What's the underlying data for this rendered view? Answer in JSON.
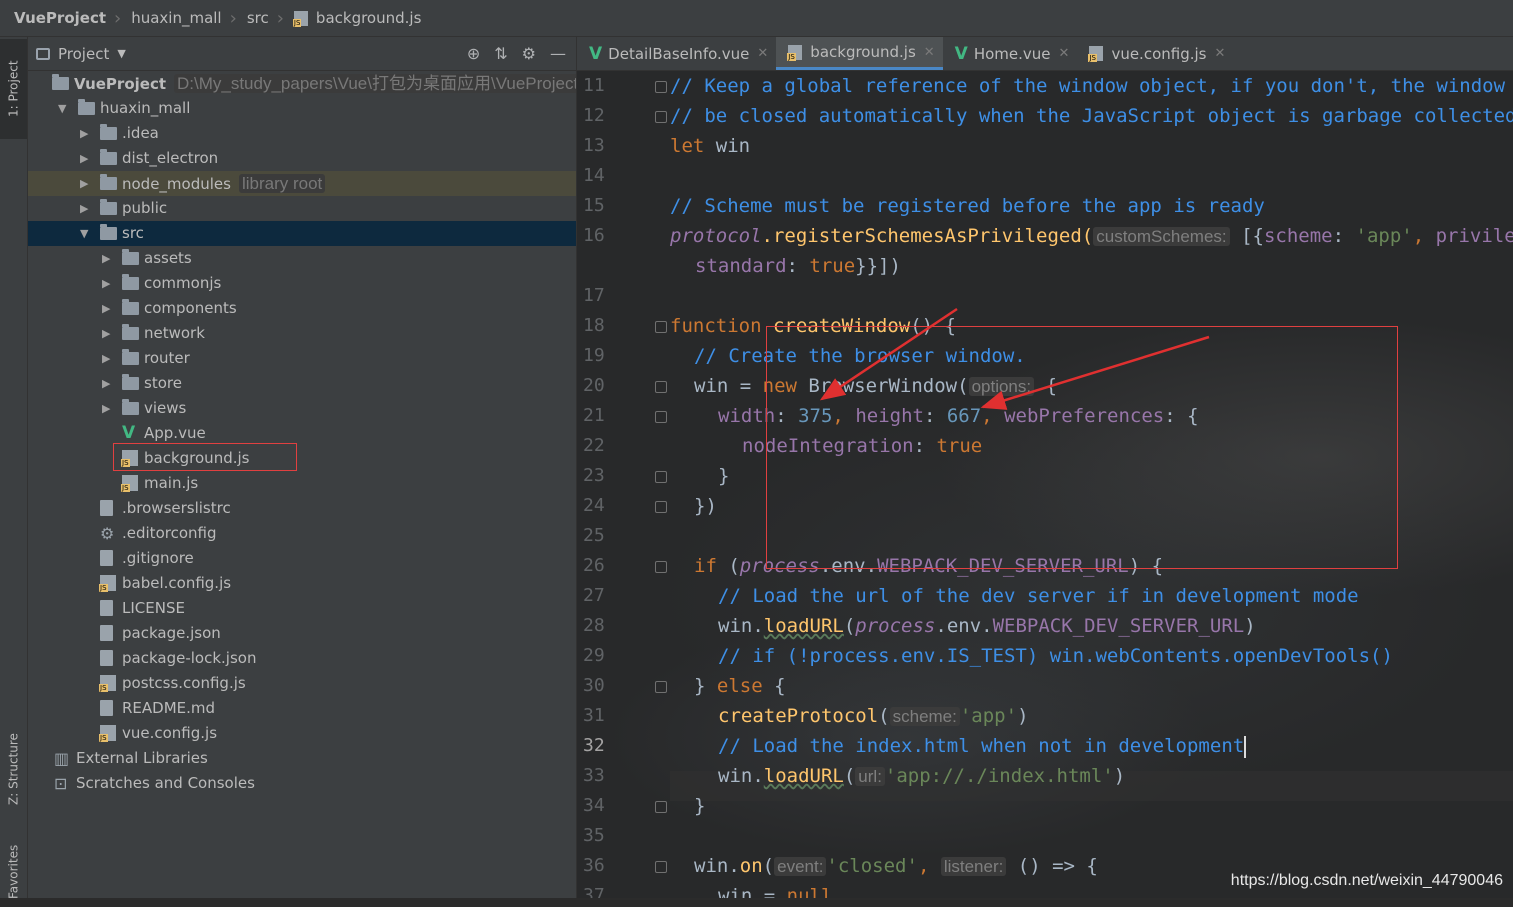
{
  "breadcrumb": [
    "VueProject",
    "huaxin_mall",
    "src",
    "background.js"
  ],
  "left_strip": {
    "project_tab": "1: Project",
    "structure_tab": "Z: Structure",
    "favorites_tab": "Favorites"
  },
  "project_panel": {
    "title": "Project",
    "tree": [
      {
        "label": "VueProject",
        "hint": "D:\\My_study_papers\\Vue\\打包为桌面应用\\VueProject",
        "type": "folder",
        "depth": 0,
        "expanded": true
      },
      {
        "label": "huaxin_mall",
        "type": "folder",
        "depth": 1,
        "expanded": true
      },
      {
        "label": ".idea",
        "type": "folder",
        "depth": 2
      },
      {
        "label": "dist_electron",
        "type": "folder",
        "depth": 2
      },
      {
        "label": "node_modules",
        "hint": "library root",
        "type": "folder",
        "depth": 2,
        "library": true
      },
      {
        "label": "public",
        "type": "folder",
        "depth": 2
      },
      {
        "label": "src",
        "type": "folder",
        "depth": 2,
        "expanded": true,
        "selected": true
      },
      {
        "label": "assets",
        "type": "folder",
        "depth": 3
      },
      {
        "label": "commonjs",
        "type": "folder",
        "depth": 3
      },
      {
        "label": "components",
        "type": "folder",
        "depth": 3
      },
      {
        "label": "network",
        "type": "folder",
        "depth": 3
      },
      {
        "label": "router",
        "type": "folder",
        "depth": 3
      },
      {
        "label": "store",
        "type": "folder",
        "depth": 3
      },
      {
        "label": "views",
        "type": "folder",
        "depth": 3
      },
      {
        "label": "App.vue",
        "type": "vue",
        "depth": 3
      },
      {
        "label": "background.js",
        "type": "js",
        "depth": 3,
        "highlighted": true
      },
      {
        "label": "main.js",
        "type": "js",
        "depth": 3
      },
      {
        "label": ".browserslistrc",
        "type": "file",
        "depth": 2
      },
      {
        "label": ".editorconfig",
        "type": "gear",
        "depth": 2
      },
      {
        "label": ".gitignore",
        "type": "file",
        "depth": 2
      },
      {
        "label": "babel.config.js",
        "type": "js",
        "depth": 2
      },
      {
        "label": "LICENSE",
        "type": "file",
        "depth": 2
      },
      {
        "label": "package.json",
        "type": "file",
        "depth": 2
      },
      {
        "label": "package-lock.json",
        "type": "file",
        "depth": 2
      },
      {
        "label": "postcss.config.js",
        "type": "js",
        "depth": 2
      },
      {
        "label": "README.md",
        "type": "file",
        "depth": 2
      },
      {
        "label": "vue.config.js",
        "type": "js",
        "depth": 2
      },
      {
        "label": "External Libraries",
        "type": "lib",
        "depth": 1
      },
      {
        "label": "Scratches and Consoles",
        "type": "scratch",
        "depth": 1
      }
    ]
  },
  "tabs": [
    {
      "label": "DetailBaseInfo.vue",
      "type": "vue",
      "active": false
    },
    {
      "label": "background.js",
      "type": "js",
      "active": true
    },
    {
      "label": "Home.vue",
      "type": "vue",
      "active": false
    },
    {
      "label": "vue.config.js",
      "type": "js",
      "active": false
    }
  ],
  "editor": {
    "line_numbers": [
      "11",
      "12",
      "13",
      "14",
      "15",
      "16",
      "",
      "17",
      "18",
      "19",
      "20",
      "21",
      "22",
      "23",
      "24",
      "25",
      "26",
      "27",
      "28",
      "29",
      "30",
      "31",
      "32",
      "33",
      "34",
      "35",
      "36",
      "37"
    ],
    "current_line": "32",
    "code": {
      "l11": "// Keep a global reference of the window object, if you don't, the window will",
      "l12": "// be closed automatically when the JavaScript object is garbage collected.",
      "l13_kw": "let",
      "l13_id": " win",
      "l15": "// Scheme must be registered before the app is ready",
      "l16_obj": "protocol",
      "l16_fn": ".registerSchemesAsPrivileged(",
      "l16_hint": "customSchemes:",
      "l16_rest1": " [{",
      "l16_key": "scheme",
      "l16_colon": ": ",
      "l16_str": "'app'",
      "l16_more": ", ",
      "l16_priv": "privileges: {",
      "l16b_key": "standard",
      "l16b_colon": ": ",
      "l16b_val": "true",
      "l16b_end": "}}])",
      "l18_kw": "function ",
      "l18_fn": "createWindow",
      "l18_end": "() {",
      "l19": "// Create the browser window.",
      "l20_a": "win = ",
      "l20_kw": "new ",
      "l20_b": "BrowserWindow(",
      "l20_hint": "options:",
      "l20_c": " {",
      "l21_k1": "width",
      "l21_v1": "375",
      "l21_k2": "height",
      "l21_v2": "667",
      "l21_k3": "webPreferences",
      "l21_end": ": {",
      "l22_k": "nodeIntegration",
      "l22_v": "true",
      "l23": "}",
      "l24": "})",
      "l26_kw": "if ",
      "l26_a": "(",
      "l26_obj": "process",
      "l26_b": ".env.",
      "l26_c": "WEBPACK_DEV_SERVER_URL",
      "l26_d": ") {",
      "l27": "// Load the url of the dev server if in development mode",
      "l28_a": "win.",
      "l28_fn": "loadURL",
      "l28_b": "(",
      "l28_obj": "process",
      "l28_c": ".env.",
      "l28_d": "WEBPACK_DEV_SERVER_URL",
      "l28_e": ")",
      "l29": "// if (!process.env.IS_TEST) win.webContents.openDevTools()",
      "l30_a": "} ",
      "l30_kw": "else",
      "l30_b": " {",
      "l31_fn": "createProtocol",
      "l31_a": "(",
      "l31_hint": "scheme:",
      "l31_str": "'app'",
      "l31_b": ")",
      "l32": "// Load the index.html when not in development",
      "l33_a": "win.",
      "l33_fn": "loadURL",
      "l33_b": "(",
      "l33_hint": "url:",
      "l33_str": "'app://./index.html'",
      "l33_c": ")",
      "l34": "}",
      "l36_a": "win.",
      "l36_fn": "on",
      "l36_b": "(",
      "l36_hint1": "event:",
      "l36_str": "'closed'",
      "l36_c": ", ",
      "l36_hint2": "listener:",
      "l36_d": " () => {",
      "l37_a": "win = ",
      "l37_kw": "null"
    }
  },
  "watermark": "https://blog.csdn.net/weixin_44790046",
  "colors": {
    "comment": "#3e8fe6",
    "keyword": "#cc7832",
    "function": "#ffc66d",
    "property": "#9876aa",
    "string": "#6a8759",
    "number": "#6897bb",
    "annotation_red": "#e04040"
  }
}
